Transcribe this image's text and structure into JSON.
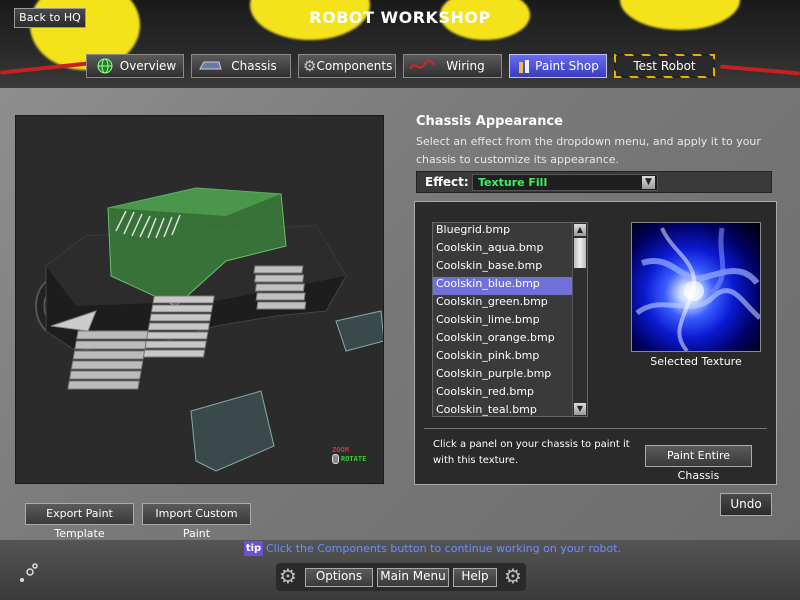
{
  "header": {
    "back_label": "Back to HQ",
    "title": "ROBOT WORKSHOP"
  },
  "tabs": [
    {
      "label": "Overview",
      "icon": "globe-icon",
      "active": false
    },
    {
      "label": "Chassis",
      "icon": "chassis-icon",
      "active": false
    },
    {
      "label": "Components",
      "icon": "gear-icon",
      "active": false
    },
    {
      "label": "Wiring",
      "icon": "wire-icon",
      "active": false
    },
    {
      "label": "Paint Shop",
      "icon": "paint-icon",
      "active": true
    },
    {
      "label": "Test Robot",
      "icon": "",
      "active": false
    }
  ],
  "viewport": {
    "zoom_label": "ZOOM",
    "rotate_label": "ROTATE"
  },
  "appearance": {
    "title": "Chassis Appearance",
    "description": "Select an effect from the dropdown menu, and apply it to your chassis to customize its appearance.",
    "effect_label": "Effect:",
    "effect_value": "Texture Fill"
  },
  "textures": {
    "items": [
      "Bluegrid.bmp",
      "Coolskin_aqua.bmp",
      "Coolskin_base.bmp",
      "Coolskin_blue.bmp",
      "Coolskin_green.bmp",
      "Coolskin_lime.bmp",
      "Coolskin_orange.bmp",
      "Coolskin_pink.bmp",
      "Coolskin_purple.bmp",
      "Coolskin_red.bmp",
      "Coolskin_teal.bmp"
    ],
    "selected_index": 3,
    "preview_caption": "Selected Texture",
    "hint": "Click a panel on your chassis to paint it with this texture.",
    "paint_entire_label": "Paint Entire Chassis"
  },
  "actions": {
    "undo_label": "Undo",
    "export_label": "Export Paint Template",
    "import_label": "Import Custom Paint"
  },
  "footer": {
    "tip_badge": "tip",
    "tip_text": "Click the Components button to continue working on your robot.",
    "options_label": "Options",
    "main_menu_label": "Main Menu",
    "help_label": "Help"
  },
  "colors": {
    "accent": "#7070d8",
    "effect_text": "#3cf060",
    "tip_text": "#6f8dff",
    "header_yellow": "#f4e21a"
  }
}
